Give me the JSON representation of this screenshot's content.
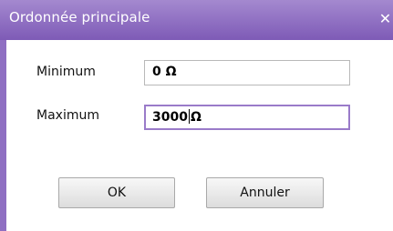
{
  "window": {
    "title": "Ordonnée principale",
    "close_symbol": "✕"
  },
  "form": {
    "min_label": "Minimum",
    "min_value_prefix": "0",
    "min_unit": "Ω",
    "max_label": "Maximum",
    "max_value_prefix": "3000",
    "max_unit": "Ω"
  },
  "buttons": {
    "ok_label": "OK",
    "cancel_label": "Annuler"
  },
  "colors": {
    "title_bar": "#8f6fc2",
    "focus_border": "#9a7bc9"
  }
}
